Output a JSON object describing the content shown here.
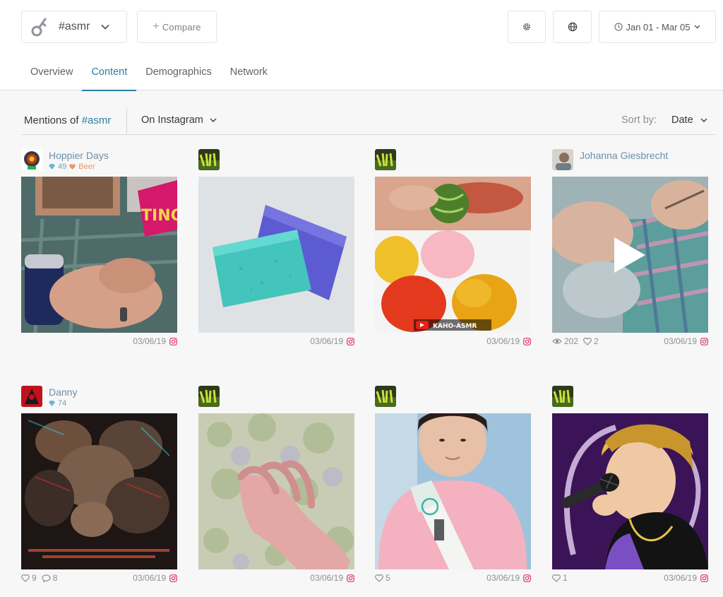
{
  "header": {
    "hashtag_select": {
      "value": "#asmr",
      "icon": "key-icon"
    },
    "compare_label": "Compare",
    "date_range": "Jan 01 - Mar 05"
  },
  "tabs": [
    {
      "label": "Overview",
      "active": false
    },
    {
      "label": "Content",
      "active": true
    },
    {
      "label": "Demographics",
      "active": false
    },
    {
      "label": "Network",
      "active": false
    }
  ],
  "filters": {
    "mentions_prefix": "Mentions of",
    "mentions_hashtag": "#asmr",
    "platform": "On Instagram",
    "sort_label": "Sort by:",
    "sort_value": "Date"
  },
  "colors": {
    "accent": "#2b7fa3",
    "instagram": "#e1306c",
    "beer_badge": "#e49a6a",
    "stat_blue": "#7a9ab3"
  },
  "posts": [
    {
      "user": "Hoppier Days",
      "followers": "49",
      "badge": "Beer",
      "date": "03/06/19",
      "platform_icon": "instagram-icon",
      "image": "man holding a beer can"
    },
    {
      "user": "",
      "date": "03/06/19",
      "platform_icon": "instagram-icon",
      "image": "teal and purple sponges"
    },
    {
      "user": "",
      "date": "03/06/19",
      "platform_icon": "instagram-icon",
      "image": "fruit shaped jelly sweets",
      "overlay_text": "KAHO-ASMR"
    },
    {
      "user": "Johanna Giesbrecht",
      "views": "202",
      "likes": "2",
      "date": "03/06/19",
      "platform_icon": "instagram-icon",
      "image": "hands knitting",
      "video": true
    },
    {
      "user": "Danny",
      "followers": "74",
      "likes": "9",
      "comments": "8",
      "date": "03/06/19",
      "platform_icon": "instagram-icon",
      "image": "glitched roses with quote"
    },
    {
      "user": "",
      "date": "03/06/19",
      "platform_icon": "instagram-icon",
      "image": "hand on textured foam"
    },
    {
      "user": "",
      "likes": "5",
      "date": "03/06/19",
      "platform_icon": "instagram-icon",
      "image": "person in pink sweater with sash"
    },
    {
      "user": "",
      "likes": "1",
      "date": "03/06/19",
      "platform_icon": "instagram-icon",
      "image": "illustration of a singer with microphone"
    }
  ]
}
